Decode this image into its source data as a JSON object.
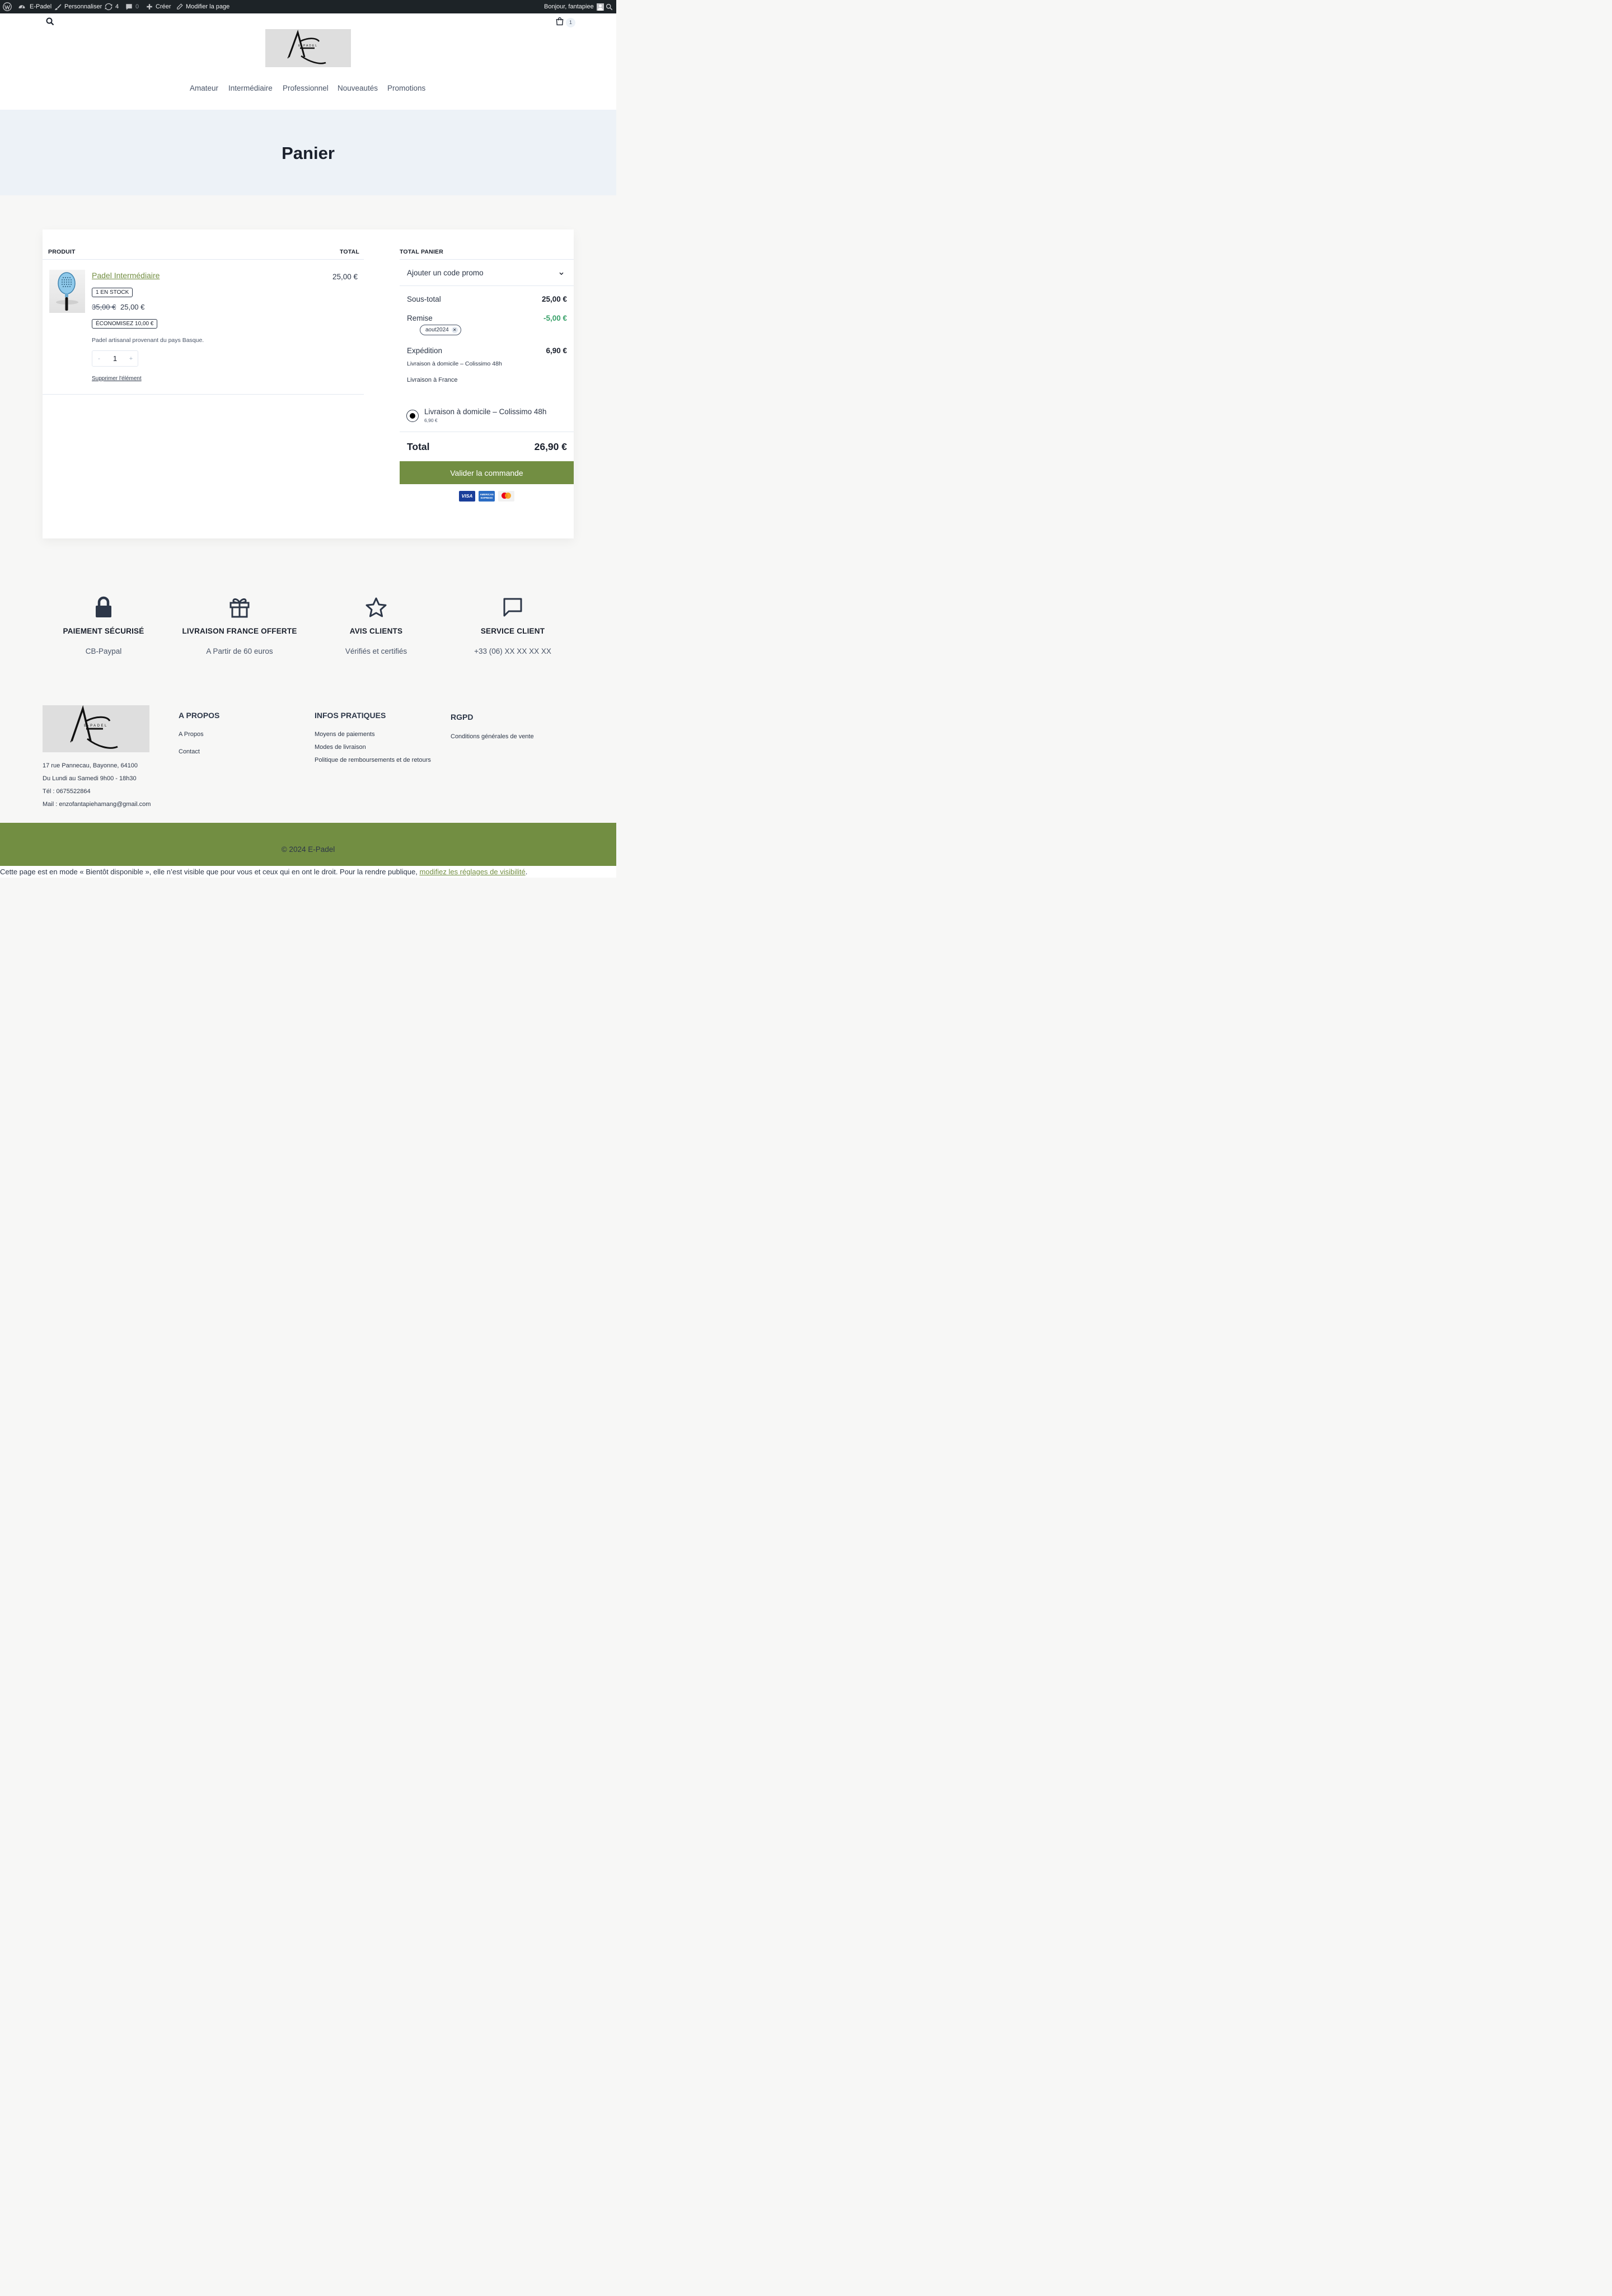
{
  "adminbar": {
    "site_name": "E-Padel",
    "customize": "Personnaliser",
    "updates_count": "4",
    "comments_count": "0",
    "create": "Créer",
    "edit_page": "Modifier la page",
    "greeting": "Bonjour, fantapiee"
  },
  "header": {
    "cart_count": "1",
    "logo_text": "E-PADEL",
    "nav": [
      "Amateur",
      "Intermédiaire",
      "Professionnel",
      "Nouveautés",
      "Promotions"
    ]
  },
  "page": {
    "title": "Panier"
  },
  "cart": {
    "col_product": "PRODUIT",
    "col_total": "TOTAL",
    "item": {
      "name": "Padel Intermédiaire",
      "stock": "1 EN STOCK",
      "old_price": "35,00 €",
      "price": "25,00 €",
      "savings": "ÉCONOMISEZ 10,00 €",
      "description": "Padel artisanal provenant du pays Basque.",
      "quantity": "1",
      "minus": "-",
      "plus": "+",
      "remove": "Supprimer l'élément",
      "line_total": "25,00 €"
    }
  },
  "summary": {
    "heading": "TOTAL PANIER",
    "promo_label": "Ajouter un code promo",
    "subtotal_label": "Sous-total",
    "subtotal_value": "25,00 €",
    "discount_label": "Remise",
    "discount_value": "-5,00 €",
    "coupon_code": "aout2024",
    "shipping_label": "Expédition",
    "shipping_value": "6,90 €",
    "shipping_method": "Livraison à domicile – Colissimo 48h",
    "shipping_destination": "Livraison à France",
    "option_label": "Livraison à domicile – Colissimo 48h",
    "option_price": "6,90 €",
    "total_label": "Total",
    "total_value": "26,90 €",
    "checkout_button": "Valider la commande",
    "payment_icons": [
      "visa-icon",
      "amex-icon",
      "mastercard-icon"
    ],
    "visa_text": "VISA",
    "amex_text": "AMERICAN EXPRESS"
  },
  "features": [
    {
      "icon": "lock-icon",
      "title": "PAIEMENT SÉCURISÉ",
      "subtitle": "CB-Paypal"
    },
    {
      "icon": "gift-icon",
      "title": "LIVRAISON FRANCE OFFERTE",
      "subtitle": "A Partir de 60 euros"
    },
    {
      "icon": "star-icon",
      "title": "AVIS CLIENTS",
      "subtitle": "Vérifiés et certifiés"
    },
    {
      "icon": "chat-icon",
      "title": "SERVICE CLIENT",
      "subtitle": "+33 (06) XX XX XX XX"
    }
  ],
  "footer": {
    "address": "17 rue Pannecau, Bayonne, 64100",
    "hours": "Du Lundi au Samedi 9h00 - 18h30",
    "phone": "Tél : 0675522864",
    "mail": "Mail : enzofantapiehamang@gmail.com",
    "col1_title": "A PROPOS",
    "col1_links": [
      "A Propos",
      "Contact"
    ],
    "col2_title": "INFOS PRATIQUES",
    "col2_links": [
      "Moyens de paiements",
      "Modes de livraison",
      "Politique de remboursements et de retours"
    ],
    "col3_title": "RGPD",
    "col3_links": [
      "Conditions générales de vente"
    ],
    "copyright": "© 2024 E-Padel"
  },
  "notice": {
    "text": "Cette page est en mode « Bientôt disponible », elle n’est visible que pour vous et ceux qui en ont le droit. Pour la rendre publique, ",
    "link": "modifiez les réglages de visibilité",
    "end": "."
  },
  "colors": {
    "accent_green": "#728e42",
    "admin_bar": "#1d2327",
    "banner": "#edf2f7",
    "discount_green": "#38a169"
  }
}
